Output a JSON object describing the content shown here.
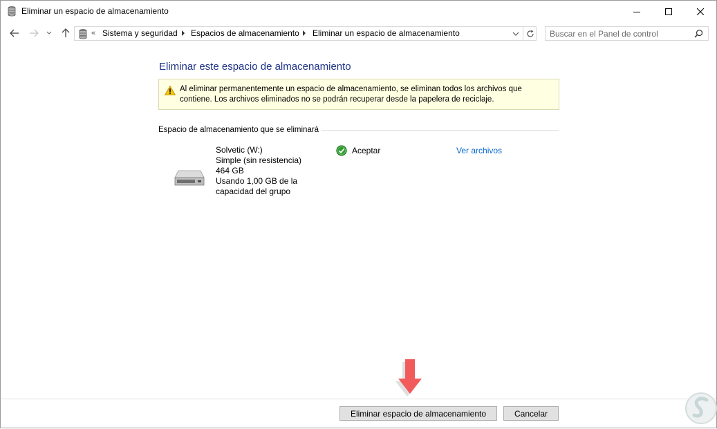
{
  "window": {
    "title": "Eliminar un espacio de almacenamiento"
  },
  "address": {
    "overflow": "«",
    "crumbs": [
      "Sistema y seguridad",
      "Espacios de almacenamiento",
      "Eliminar un espacio de almacenamiento"
    ]
  },
  "search": {
    "placeholder": "Buscar en el Panel de control"
  },
  "content": {
    "title": "Eliminar este espacio de almacenamiento",
    "warning_line1": "Al eliminar permanentemente un espacio de almacenamiento, se eliminan todos los archivos que",
    "warning_line2": "contiene. Los archivos eliminados no se podrán recuperar desde la papelera de reciclaje.",
    "section_label": "Espacio de almacenamiento que se eliminará",
    "drive": {
      "name": "Solvetic (W:)",
      "type": "Simple (sin resistencia)",
      "size": "464 GB",
      "usage": "Usando 1,00 GB de la capacidad del grupo"
    },
    "status": "Aceptar",
    "view_files": "Ver archivos"
  },
  "footer": {
    "delete_label": "Eliminar espacio de almacenamiento",
    "cancel_label": "Cancelar"
  },
  "colors": {
    "title": "#1e3287",
    "link": "#0066cc",
    "warning_bg": "#ffffe1",
    "annotation_arrow": "#f25b5b",
    "status_ok": "#2f9e2f"
  }
}
